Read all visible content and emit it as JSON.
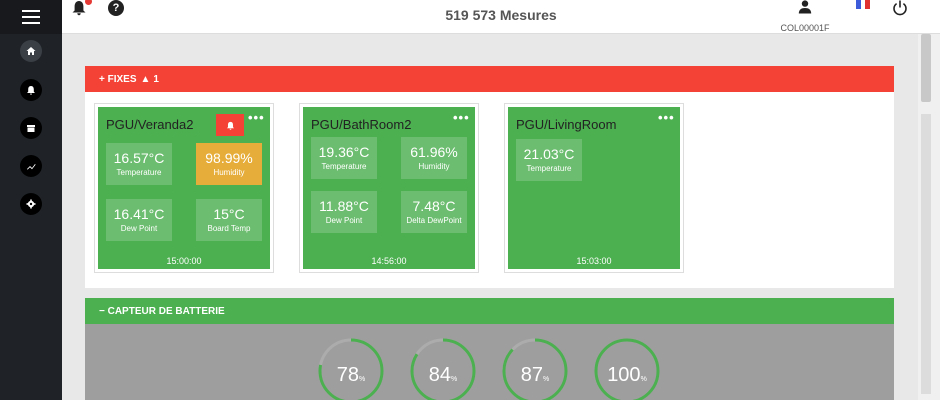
{
  "header": {
    "mesures": "519 573 Mesures",
    "user_id": "COL00001F"
  },
  "sidebar": {
    "items": [
      {
        "icon": "home-icon"
      },
      {
        "icon": "bell-icon"
      },
      {
        "icon": "archive-icon"
      },
      {
        "icon": "trend-icon"
      },
      {
        "icon": "gear-icon"
      }
    ]
  },
  "fixes": {
    "label": "+ FIXES",
    "alert_count": "1",
    "color": "#f44336"
  },
  "cards": [
    {
      "title": "PGU/Veranda2",
      "time": "15:00:00",
      "has_alert": true,
      "tiles": [
        {
          "value": "16.57°C",
          "label": "Temperature",
          "warn": false
        },
        {
          "value": "98.99%",
          "label": "Humidity",
          "warn": true
        },
        {
          "value": "16.41°C",
          "label": "Dew Point",
          "warn": false
        },
        {
          "value": "15°C",
          "label": "Board Temp",
          "warn": false
        }
      ]
    },
    {
      "title": "PGU/BathRoom2",
      "time": "14:56:00",
      "has_alert": false,
      "tiles": [
        {
          "value": "19.36°C",
          "label": "Temperature",
          "warn": false
        },
        {
          "value": "61.96%",
          "label": "Humidity",
          "warn": false
        },
        {
          "value": "11.88°C",
          "label": "Dew Point",
          "warn": false
        },
        {
          "value": "7.48°C",
          "label": "Delta DewPoint",
          "warn": false
        }
      ]
    },
    {
      "title": "PGU/LivingRoom",
      "time": "15:03:00",
      "has_alert": false,
      "tiles": [
        {
          "value": "21.03°C",
          "label": "Temperature",
          "warn": false
        }
      ]
    }
  ],
  "battery": {
    "label": "− CAPTEUR DE BATTERIE",
    "unit": "%",
    "levels": [
      78,
      84,
      87,
      100
    ],
    "color": "#4caf50"
  }
}
